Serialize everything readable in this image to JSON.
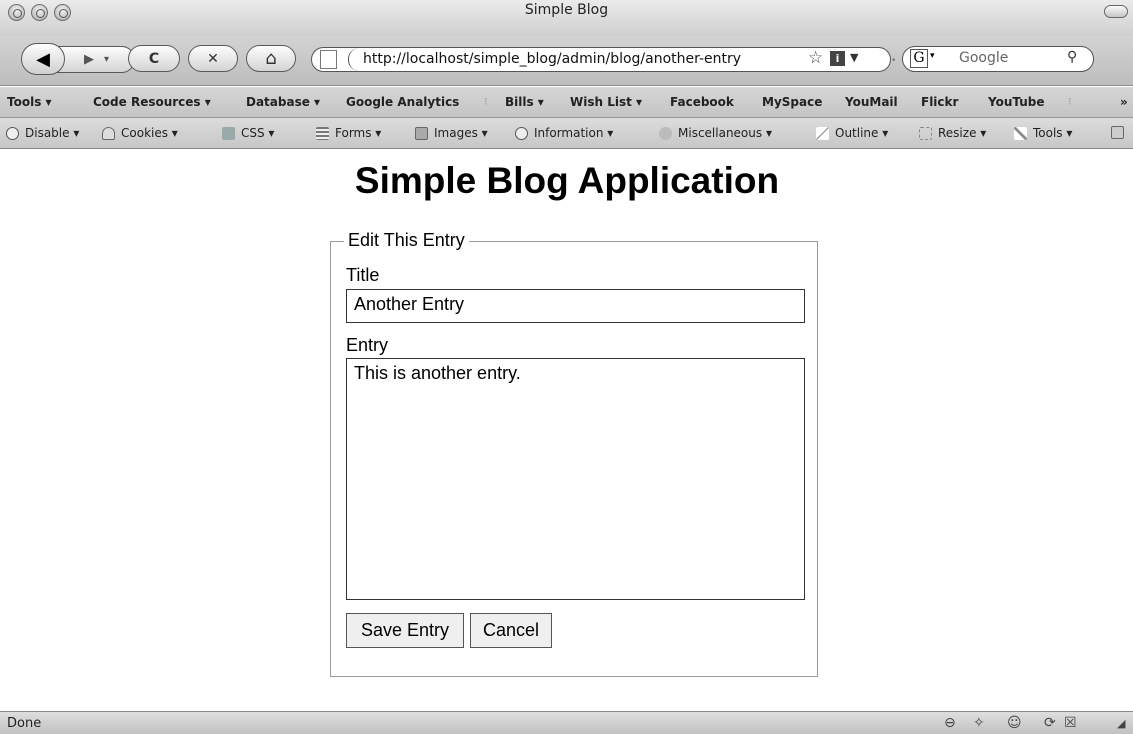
{
  "window": {
    "title": "Simple Blog"
  },
  "nav": {
    "back_glyph": "◀",
    "forward_glyph": "▶",
    "reload_glyph": "C",
    "stop_glyph": "✕",
    "home_glyph": "⌂",
    "url": "http://localhost/simple_blog/admin/blog/another-entry",
    "search_engine_letter": "G",
    "search_placeholder": "Google"
  },
  "bookmarks": [
    "Tools ▾",
    "Code Resources ▾",
    "Database ▾",
    "Google Analytics",
    "Bills ▾",
    "Wish List ▾",
    "Facebook",
    "MySpace",
    "YouMail",
    "Flickr",
    "YouTube"
  ],
  "bookmarks_overflow": "»",
  "devtoolbar": [
    "Disable ▾",
    "Cookies ▾",
    "CSS ▾",
    "Forms ▾",
    "Images ▾",
    "Information ▾",
    "Miscellaneous ▾",
    "Outline ▾",
    "Resize ▾",
    "Tools ▾"
  ],
  "page": {
    "heading": "Simple Blog Application",
    "form": {
      "legend": "Edit This Entry",
      "title_label": "Title",
      "title_value": "Another Entry",
      "entry_label": "Entry",
      "entry_value": "This is another entry.",
      "save_label": "Save Entry",
      "cancel_label": "Cancel"
    }
  },
  "status": {
    "text": "Done"
  }
}
